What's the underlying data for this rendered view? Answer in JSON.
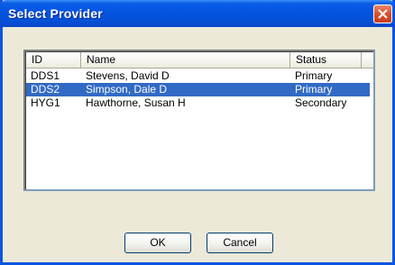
{
  "window": {
    "title": "Select Provider"
  },
  "list": {
    "columns": [
      "ID",
      "Name",
      "Status"
    ],
    "rows": [
      {
        "id": "DDS1",
        "name": "Stevens, David D",
        "status": "Primary",
        "selected": false
      },
      {
        "id": "DDS2",
        "name": "Simpson, Dale D",
        "status": "Primary",
        "selected": true
      },
      {
        "id": "HYG1",
        "name": "Hawthorne, Susan H",
        "status": "Secondary",
        "selected": false
      }
    ]
  },
  "buttons": {
    "ok_label": "OK",
    "cancel_label": "Cancel"
  },
  "colors": {
    "titlebar": "#0553e0",
    "selection": "#316ac5",
    "close": "#d9502c",
    "face": "#ece9d8"
  }
}
